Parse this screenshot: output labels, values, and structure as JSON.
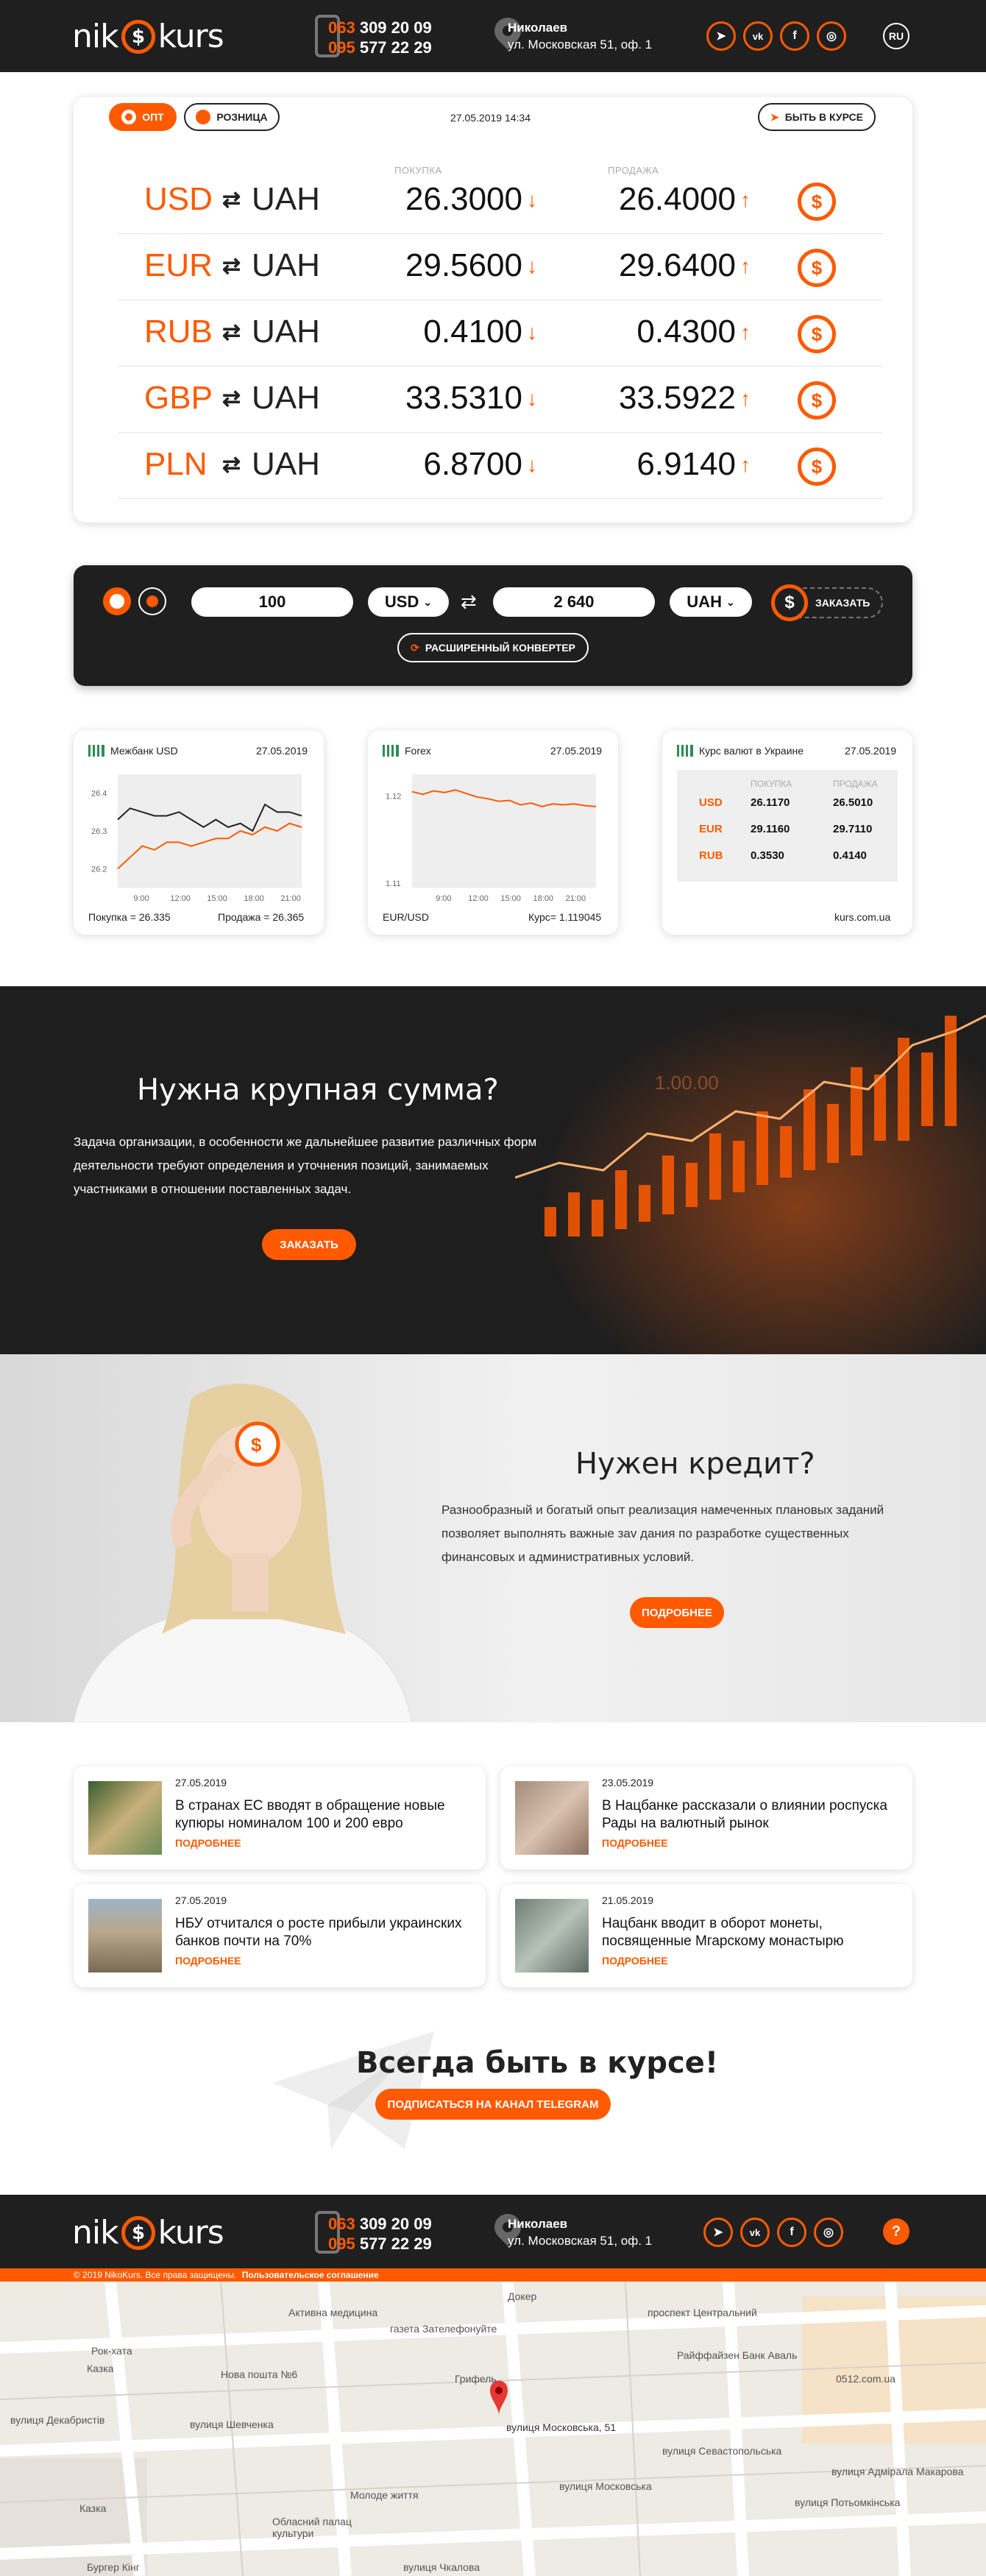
{
  "header": {
    "logo_left": "nik",
    "logo_coin": "$",
    "logo_right": "kurs",
    "phone1_prefix": "063",
    "phone1_rest": " 309 20 09",
    "phone2_prefix": "095",
    "phone2_rest": " 577 22 29",
    "city": "Николаев",
    "street": "ул. Московская 51, оф. 1",
    "social": [
      "➤",
      "vk",
      "f",
      "◎"
    ],
    "lang": "RU"
  },
  "rates": {
    "tab_wholesale": "ОПТ",
    "tab_retail": "РОЗНИЦА",
    "datetime": "27.05.2019 14:34",
    "subscribe": "БЫТЬ В КУРСЕ",
    "col_buy": "ПОКУПКА",
    "col_sell": "ПРОДАЖА",
    "rows": [
      {
        "cur": "USD",
        "base": "UAH",
        "buy": "26.3000",
        "sell": "26.4000"
      },
      {
        "cur": "EUR",
        "base": "UAH",
        "buy": "29.5600",
        "sell": "29.6400"
      },
      {
        "cur": "RUB",
        "base": "UAH",
        "buy": "0.4100",
        "sell": "0.4300"
      },
      {
        "cur": "GBP",
        "base": "UAH",
        "buy": "33.5310",
        "sell": "33.5922"
      },
      {
        "cur": "PLN",
        "base": "UAH",
        "buy": "6.8700",
        "sell": "6.9140"
      }
    ],
    "swap_glyph": "⇄",
    "down_glyph": "↓",
    "up_glyph": "↑",
    "coin_glyph": "$"
  },
  "converter": {
    "amount": "100",
    "from": "USD",
    "result": "2 640",
    "to": "UAH",
    "order": "ЗАКАЗАТЬ",
    "extended": "РАСШИРЕННЫЙ КОНВЕРТЕР"
  },
  "widgets": {
    "w1": {
      "title": "Межбанк USD",
      "date": "27.05.2019",
      "buy": "Покупка = 26.335",
      "sell": "Продажа = 26.365",
      "yticks": [
        "26.4",
        "26.3",
        "26.2"
      ],
      "xticks": [
        "9:00",
        "12:00",
        "15:00",
        "18:00",
        "21:00"
      ]
    },
    "w2": {
      "title": "Forex",
      "date": "27.05.2019",
      "pair": "EUR/USD",
      "rate": "Курс= 1.119045",
      "yticks": [
        "1.12",
        "1.11"
      ],
      "xticks": [
        "9:00",
        "12:00",
        "15:00",
        "18:00",
        "21:00"
      ]
    },
    "w3": {
      "title": "Курс валют в Украине",
      "date": "27.05.2019",
      "col_buy": "ПОКУПКА",
      "col_sell": "ПРОДАЖА",
      "source": "kurs.com.ua",
      "rows": [
        {
          "cur": "USD",
          "buy": "26.1170",
          "sell": "26.5010"
        },
        {
          "cur": "EUR",
          "buy": "29.1160",
          "sell": "29.7110"
        },
        {
          "cur": "RUB",
          "buy": "0.3530",
          "sell": "0.4140"
        }
      ]
    }
  },
  "chart_data": [
    {
      "type": "line",
      "title": "Межбанк USD",
      "x": [
        "7:00",
        "8:00",
        "9:00",
        "10:00",
        "11:00",
        "12:00",
        "13:00",
        "14:00",
        "15:00",
        "16:00",
        "17:00",
        "18:00",
        "19:00",
        "20:00",
        "21:00",
        "22:00"
      ],
      "series": [
        {
          "values": [
            26.33,
            26.36,
            26.35,
            26.34,
            26.34,
            26.35,
            26.33,
            26.31,
            26.33,
            26.31,
            26.32,
            26.3,
            26.37,
            26.35,
            26.35,
            26.34
          ],
          "color": "#222222"
        },
        {
          "values": [
            26.2,
            26.23,
            26.26,
            26.25,
            26.27,
            26.27,
            26.26,
            26.27,
            26.28,
            26.28,
            26.3,
            26.29,
            26.31,
            26.3,
            26.32,
            26.31
          ],
          "color": "#ff5a00"
        }
      ],
      "ylim": [
        26.15,
        26.45
      ]
    },
    {
      "type": "line",
      "title": "Forex",
      "x": [
        "6:00",
        "7:00",
        "8:00",
        "9:00",
        "10:00",
        "11:00",
        "12:00",
        "13:00",
        "14:00",
        "15:00",
        "16:00",
        "17:00",
        "18:00",
        "19:00",
        "20:00",
        "21:00",
        "22:00",
        "23:00"
      ],
      "series": [
        {
          "values": [
            1.1205,
            1.1202,
            1.1206,
            1.1204,
            1.1207,
            1.1203,
            1.1199,
            1.1197,
            1.1194,
            1.1195,
            1.119,
            1.1192,
            1.1188,
            1.1191,
            1.119,
            1.1191,
            1.1189,
            1.1188
          ],
          "color": "#ff5a00"
        }
      ],
      "ylim": [
        1.1095,
        1.1225
      ]
    }
  ],
  "banner1": {
    "title": "Нужна крупная сумма?",
    "text1": "Задача организации, в особенности же дальнейшее развитие различных форм",
    "text2": "деятельности требуют определения и уточнения позиций, занимаемых",
    "text3": "участниками в отношении поставленных задач.",
    "button": "ЗАКАЗАТЬ",
    "chart_label": "1.00.00"
  },
  "banner2": {
    "title": "Нужен кредит?",
    "text1": "Разнообразный и богатый опыт реализация намеченных плановых заданий",
    "text2": "позволяет выполнять важные зav дания по разработке существенных",
    "text3": "финансовых и административных условий.",
    "button": "ПОДРОБНЕЕ"
  },
  "news": [
    {
      "date": "27.05.2019",
      "title": "В странах ЕС вводят в обращение новые купюры номиналом 100 и 200 евро",
      "more": "ПОДРОБНЕЕ"
    },
    {
      "date": "23.05.2019",
      "title": "В Нацбанке рассказали о влиянии роспуска Рады на валютный рынок",
      "more": "ПОДРОБНЕЕ"
    },
    {
      "date": "27.05.2019",
      "title": "НБУ отчитался о росте прибыли украинских банков почти на 70%",
      "more": "ПОДРОБНЕЕ"
    },
    {
      "date": "21.05.2019",
      "title": "Нацбанк вводит в оборот монеты, посвященные Мгарскому монастырю",
      "more": "ПОДРОБНЕЕ"
    }
  ],
  "telegram": {
    "title": "Всегда быть в курсе!",
    "button": "ПОДПИСАТЬСЯ НА КАНАЛ TELEGRAM"
  },
  "footer": {
    "help": "?",
    "copyright": "© 2019 NikoKurs. Все права защищены.",
    "agreement": "Пользовательское соглашение"
  },
  "map": {
    "labels": [
      "Докер",
      "Активна медицина",
      "газета Зателефонуйте",
      "Райффайзен Банк Аваль",
      "0512.com.ua",
      "Рок-хата",
      "Казка",
      "Нова пошта №6",
      "Грифель",
      "вулиця Шевченка",
      "Молоде життя",
      "Обласний палац культури",
      "Казка",
      "Бургер Кінг",
      "вулиця Московська, 51",
      "проспект Центральний",
      "вулиця Чкалова",
      "вулиця Севастопольська",
      "вулиця Потьомкінська",
      "вулиця Декабристів",
      "вулиця Адмірала Макарова",
      "вулиця Московська"
    ]
  }
}
